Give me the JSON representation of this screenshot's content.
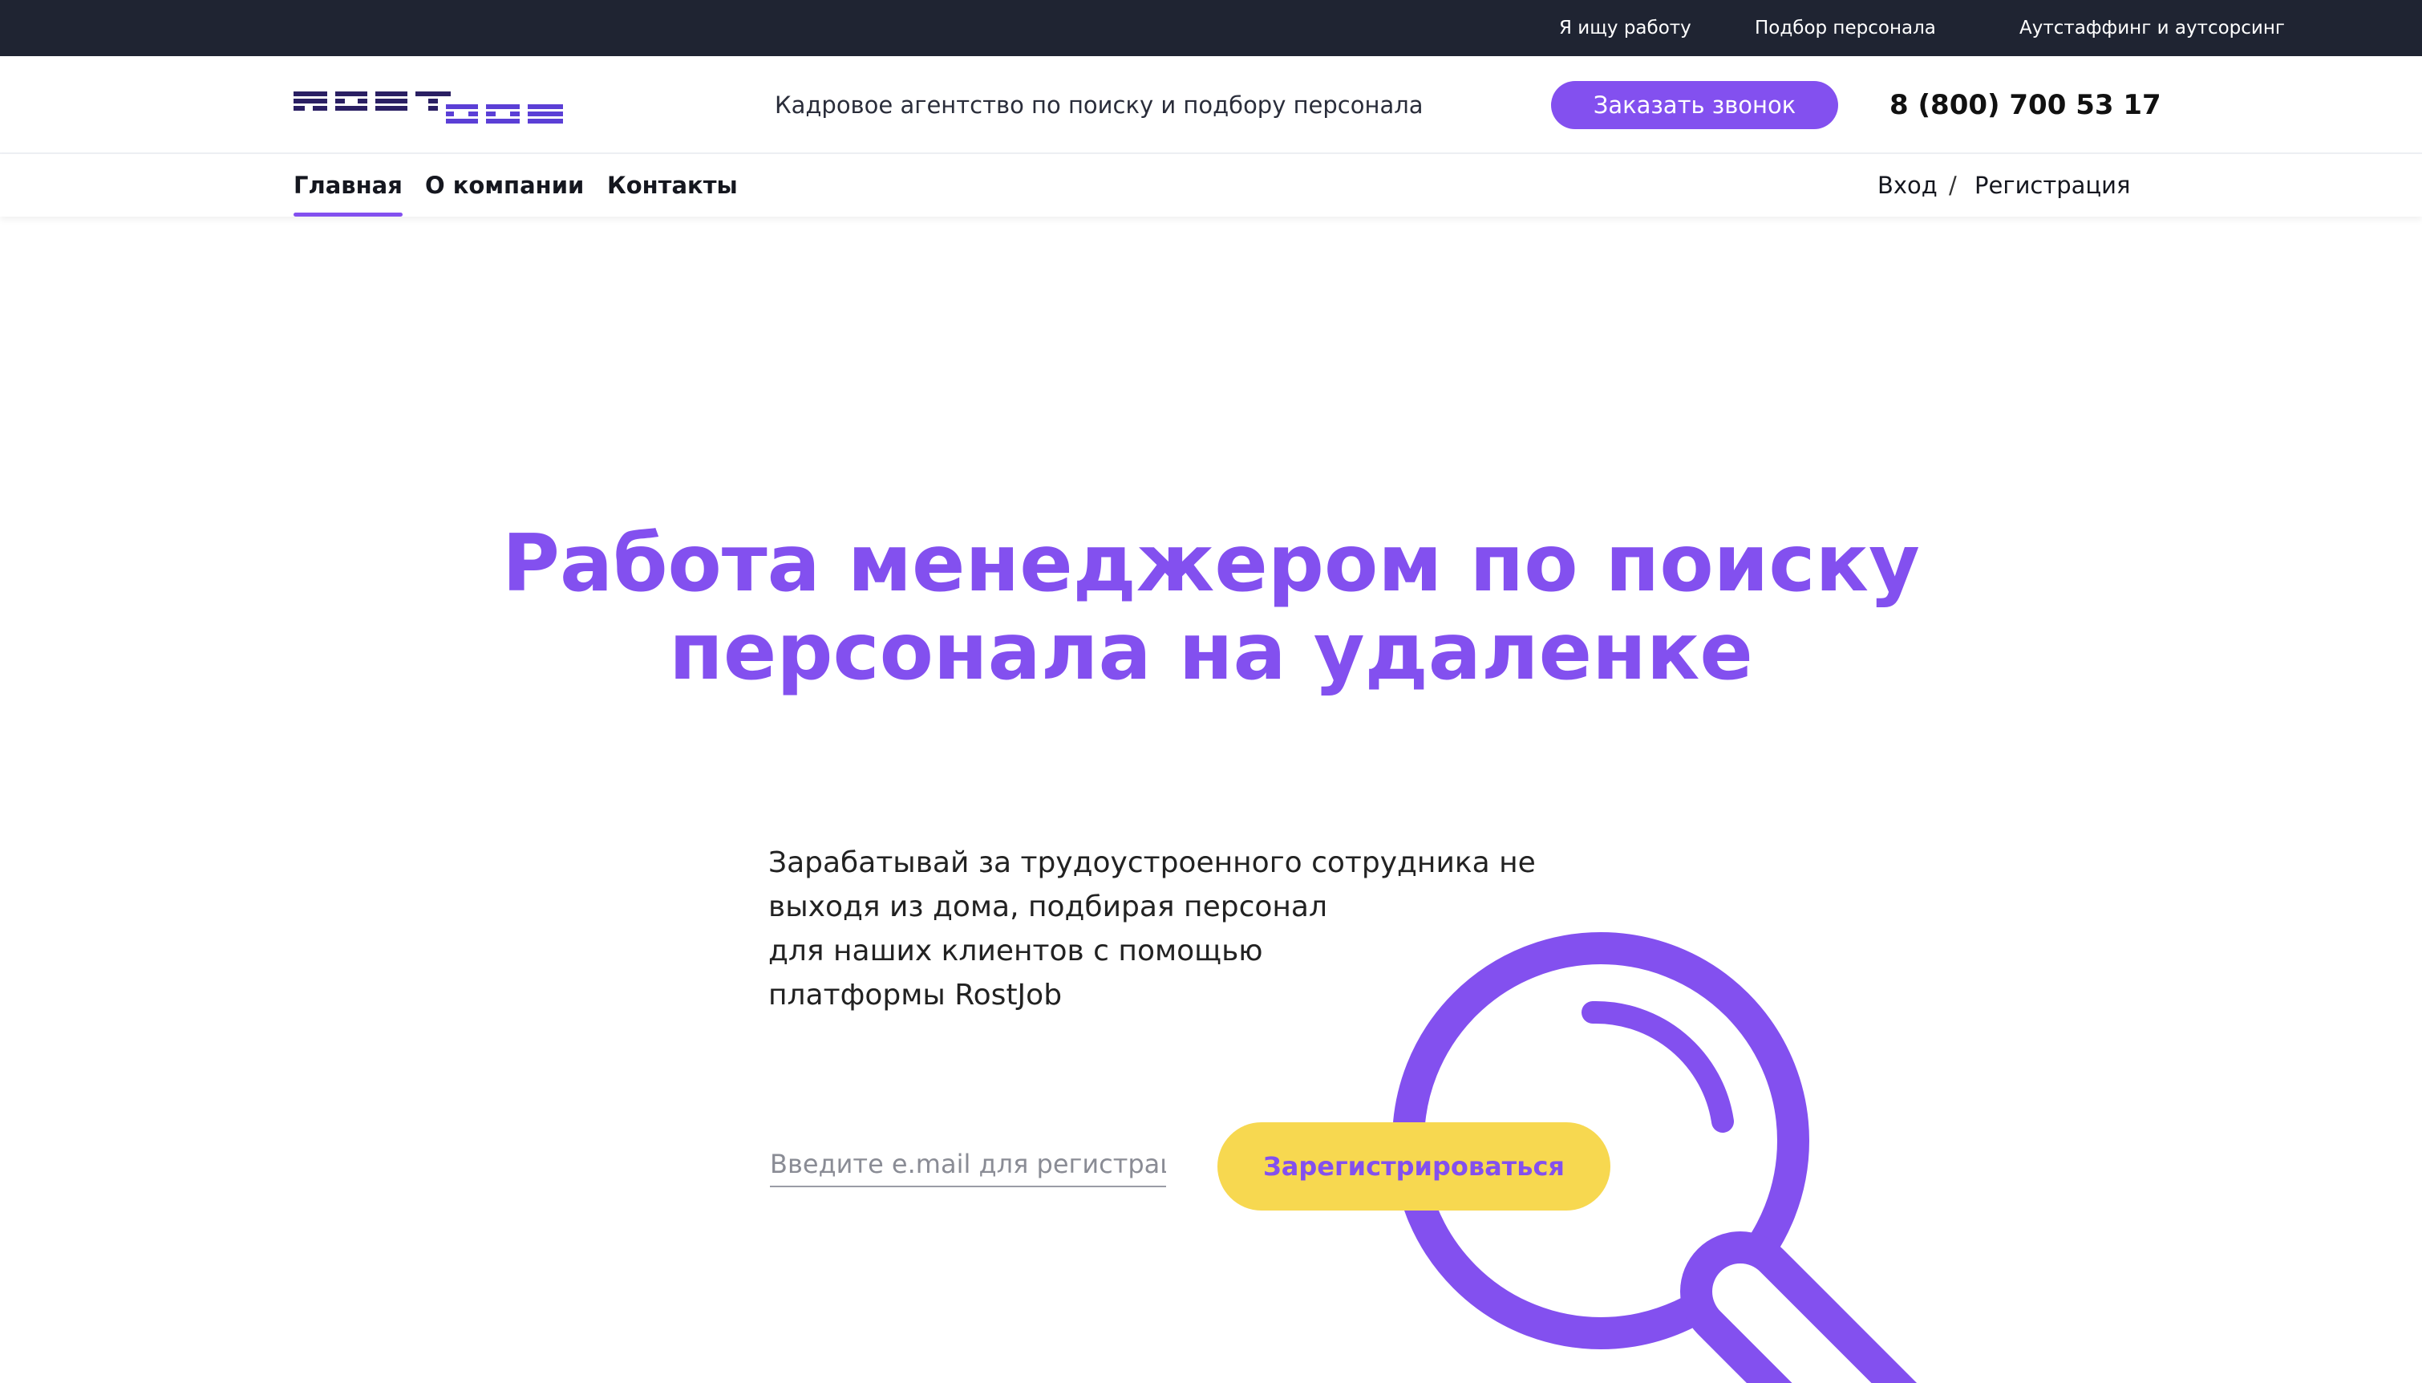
{
  "topbar": {
    "links": [
      "Я ищу работу",
      "Подбор персонала",
      "Аутстаффинг и аутсорсинг"
    ]
  },
  "header": {
    "logo_text": "ROSTJOB",
    "tagline": "Кадровое агентство по поиску и подбору персонала",
    "call_button": "Заказать звонок",
    "phone": "8 (800) 700 53 17"
  },
  "nav": {
    "items": [
      "Главная",
      "О компании",
      "Контакты"
    ],
    "active": "Главная",
    "login": "Вход",
    "separator": "/",
    "register": "Регистрация"
  },
  "hero": {
    "title_line1": "Работа менеджером по поиску",
    "title_line2": "персонала на удаленке",
    "text_lines": [
      "Зарабатывай за трудоустроенного сотрудника не",
      "выходя из дома, подбирая персонал",
      "для наших клиентов с помощью",
      "платформы RostJob"
    ],
    "email_placeholder": "Введите e.mail для регистрации",
    "register_button": "Зарегистрироваться"
  },
  "colors": {
    "accent": "#8350ef",
    "topbar_bg": "#1f2432",
    "button_yellow": "#f7d850",
    "logo_dark": "#2a1f63"
  },
  "icons": [
    "magnifier-illustration"
  ]
}
